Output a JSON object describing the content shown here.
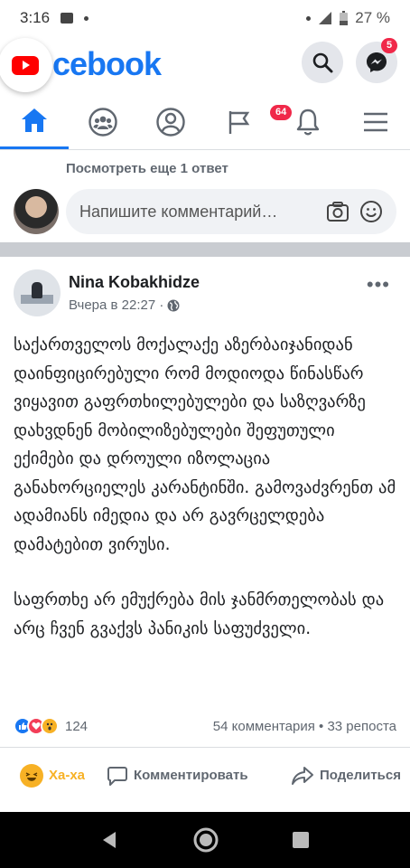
{
  "status_bar": {
    "time": "3:16",
    "battery": "27 %",
    "icons": [
      "message-icon",
      "signal-icon",
      "battery-icon"
    ]
  },
  "header": {
    "brand": "cebook",
    "overlay_app": "youtube-icon",
    "messenger_badge": "5",
    "colors": {
      "brand": "#1877f2",
      "badge": "#f02849"
    }
  },
  "tabs": [
    {
      "icon": "home-icon",
      "active": true
    },
    {
      "icon": "groups-icon"
    },
    {
      "icon": "profile-icon"
    },
    {
      "icon": "flag-icon",
      "badge": "64"
    },
    {
      "icon": "bell-icon"
    },
    {
      "icon": "menu-icon"
    }
  ],
  "comments": {
    "more_replies": "Посмотреть еще 1 ответ",
    "input_placeholder": "Напишите комментарий…"
  },
  "post": {
    "author": "Nina Kobakhidze",
    "timestamp": "Вчера в 22:27 ·",
    "paragraphs": [
      "საქართველოს მოქალაქე აზერბაიჯანიდან დაინფიცირებული რომ მოდიოდა წინასწარ ვიყავით გაფრთხილებულები და საზღვარზე დახვდნენ მობილიზებულები შეფუთული ექიმები და დროული იზოლაცია განახორციელეს კარანტინში. გამოვაძვრენთ ამ ადამიანს იმედია და არ გავრცელდება დამატებით ვირუსი.",
      "საფრთხე არ ემუქრება მის ჯანმრთელობას და არც ჩვენ გვაქვს პანიკის საფუძველი."
    ],
    "reactions": {
      "count": "124",
      "comments_shares": "54 комментария • 33 репоста"
    },
    "actions": {
      "haha": "Ха-ха",
      "comment": "Комментировать",
      "share": "Поделиться"
    }
  }
}
